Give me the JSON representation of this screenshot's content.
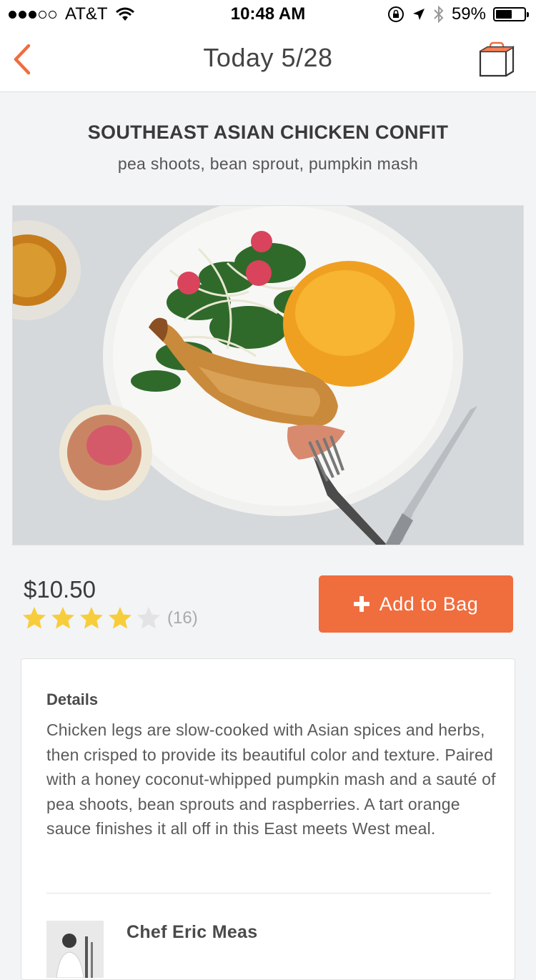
{
  "status_bar": {
    "carrier": "AT&T",
    "time": "10:48 AM",
    "battery_percent": "59%",
    "battery_level": 0.59,
    "signal_bars_filled": 3,
    "signal_bars_total": 5,
    "icons": [
      "wifi-icon",
      "rotation-lock-icon",
      "location-arrow-icon",
      "bluetooth-icon",
      "battery-icon"
    ]
  },
  "nav": {
    "title": "Today 5/28",
    "back_icon": "chevron-left-icon",
    "bag_icon": "shopping-bag-icon"
  },
  "dish": {
    "name": "SOUTHEAST ASIAN CHICKEN CONFIT",
    "subtitle": "pea shoots, bean sprout, pumpkin mash"
  },
  "purchase": {
    "price": "$10.50",
    "rating": 4,
    "rating_max": 5,
    "rating_count": "(16)",
    "add_label": "Add to Bag"
  },
  "details": {
    "label": "Details",
    "text": "Chicken legs are slow-cooked with Asian spices and herbs, then crisped to provide its beautiful color and texture.  Paired with a honey coconut-whipped pumpkin mash and a sauté of pea shoots, bean sprouts and raspberries.  A tart orange sauce finishes it all off in this East meets West meal."
  },
  "chef": {
    "name": "Chef Eric Meas"
  },
  "colors": {
    "accent": "#f06d3e",
    "star_on": "#f8cd3c",
    "star_off": "#e3e3e3",
    "background": "#f3f4f6"
  }
}
